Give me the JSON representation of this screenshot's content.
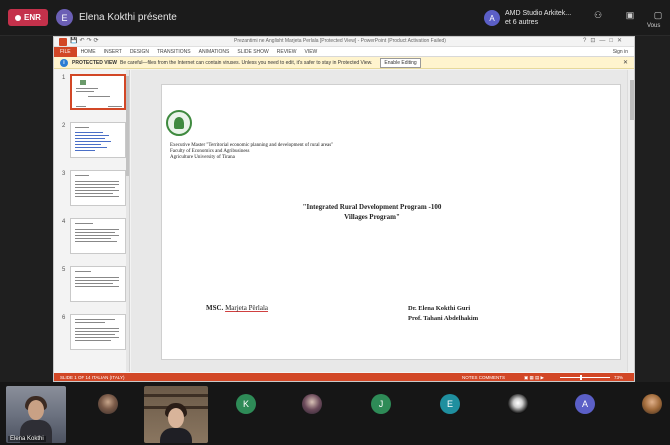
{
  "teams": {
    "record_label": "ENR",
    "presenter_initial": "E",
    "presenter_text": "Elena Kokthi présente",
    "group_initial": "A",
    "group_name_line1": "AMD Studio Arkitek...",
    "group_name_line2": "et 6 autres",
    "vous_label": "Vous",
    "accent": "#5b5fc7",
    "record_color": "#c4314b"
  },
  "ppt": {
    "window_title": "Prezantimi ne Anglisht Marjeta Perlala [Protected View] - PowerPoint (Product Activation Failed)",
    "tabs": [
      "FILE",
      "HOME",
      "INSERT",
      "DESIGN",
      "TRANSITIONS",
      "ANIMATIONS",
      "SLIDE SHOW",
      "REVIEW",
      "VIEW"
    ],
    "sign_in": "Sign in",
    "protected_title": "PROTECTED VIEW",
    "protected_text": "Be careful—files from the Internet can contain viruses. Unless you need to edit, it's safer to stay in Protected View.",
    "enable_editing": "Enable Editing",
    "accent": "#d24726",
    "slide_numbers": [
      "1",
      "2",
      "3",
      "4",
      "5",
      "6"
    ],
    "slide": {
      "master_line1": "Executive Master \"Territorial economic planning and development of rural areas\"",
      "master_line2": "Faculty of Economics and Agribusiness",
      "master_line3": "Agriculture University of Tirana",
      "title_line1": "\"Integrated Rural Development Program -100",
      "title_line2": "Villages Program\"",
      "msc_label": "MSC.",
      "msc_name": "Marjeta Përlala",
      "supervisor1": "Dr. Elena Kokthi Guri",
      "supervisor2": "Prof. Tahani Abdelhakim"
    },
    "status_left": "SLIDE 1 OF 14     ITALIAN (ITALY)",
    "status_notes": "NOTES    COMMENTS",
    "zoom_pct": "73%"
  },
  "participants": {
    "self_label": "Elena Kokthi",
    "initials": [
      "K",
      "J",
      "E",
      "A"
    ]
  }
}
